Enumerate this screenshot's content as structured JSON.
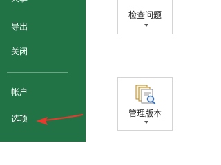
{
  "sidebar": {
    "accent_color": "#217346",
    "items": [
      {
        "label": "共享"
      },
      {
        "label": "导出"
      },
      {
        "label": "关闭"
      },
      {
        "label": "帐户"
      },
      {
        "label": "选项"
      }
    ]
  },
  "main": {
    "tiles": [
      {
        "label": "检查问题",
        "icon": "inspect-icon"
      },
      {
        "label": "管理版本",
        "icon": "manage-versions-icon"
      }
    ]
  },
  "annotation": {
    "color": "#e8392f",
    "icon": "red-arrow"
  }
}
